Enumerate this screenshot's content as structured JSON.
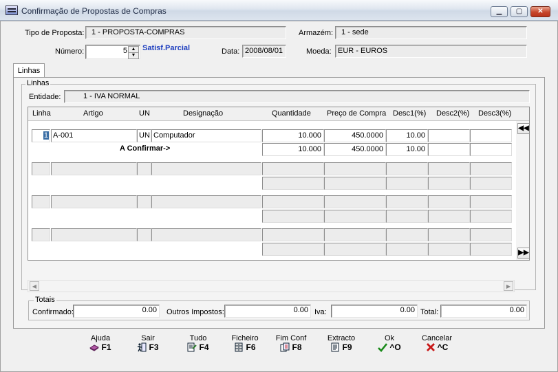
{
  "window": {
    "title": "Confirmação de Propostas de Compras"
  },
  "header": {
    "tipo_label": "Tipo de Proposta:",
    "tipo_value": "1 - PROPOSTA-COMPRAS",
    "armazem_label": "Armazém:",
    "armazem_value": "1 - sede",
    "numero_label": "Número:",
    "numero_value": "5",
    "status": "Satisf.Parcial",
    "data_label": "Data:",
    "data_value": "2008/08/01",
    "moeda_label": "Moeda:",
    "moeda_value": "EUR - EUROS"
  },
  "tabs": [
    {
      "label": "Linhas"
    }
  ],
  "linhas": {
    "group_title": "Linhas",
    "entidade_label": "Entidade:",
    "entidade_value": "1 - IVA NORMAL",
    "columns": [
      "Linha",
      "Artigo",
      "UN",
      "Designação",
      "Quantidade",
      "Preço de Compra",
      "Desc1(%)",
      "Desc2(%)",
      "Desc3(%)"
    ],
    "row": {
      "linha": "1",
      "artigo": "A-001",
      "un": "UN",
      "designacao": "Computador",
      "quantidade": "10.000",
      "preco": "450.0000",
      "desc1": "10.00",
      "desc2": "",
      "desc3": ""
    },
    "confirm_label": "A Confirmar->",
    "confirm_row": {
      "quantidade": "10.000",
      "preco": "450.0000",
      "desc1": "10.00",
      "desc2": "",
      "desc3": ""
    }
  },
  "totais": {
    "group_title": "Totais",
    "confirmado_label": "Confirmado:",
    "confirmado_value": "0.00",
    "outros_label": "Outros Impostos:",
    "outros_value": "0.00",
    "iva_label": "Iva:",
    "iva_value": "0.00",
    "total_label": "Total:",
    "total_value": "0.00"
  },
  "toolbar": [
    {
      "label": "Ajuda",
      "key": "F1",
      "icon": "help-book-icon"
    },
    {
      "label": "Sair",
      "key": "F3",
      "icon": "exit-door-icon"
    },
    {
      "label": "Tudo",
      "key": "F4",
      "icon": "select-all-icon"
    },
    {
      "label": "Ficheiro",
      "key": "F6",
      "icon": "file-cabinet-icon"
    },
    {
      "label": "Fim Conf",
      "key": "F8",
      "icon": "finish-confirm-icon"
    },
    {
      "label": "Extracto",
      "key": "F9",
      "icon": "statement-icon"
    },
    {
      "label": "Ok",
      "key": "^O",
      "icon": "check-icon"
    },
    {
      "label": "Cancelar",
      "key": "^C",
      "icon": "cancel-x-icon"
    }
  ],
  "colors": {
    "status": "#1f3fbf",
    "ok": "#1a8a1a",
    "cancel": "#c81818"
  }
}
